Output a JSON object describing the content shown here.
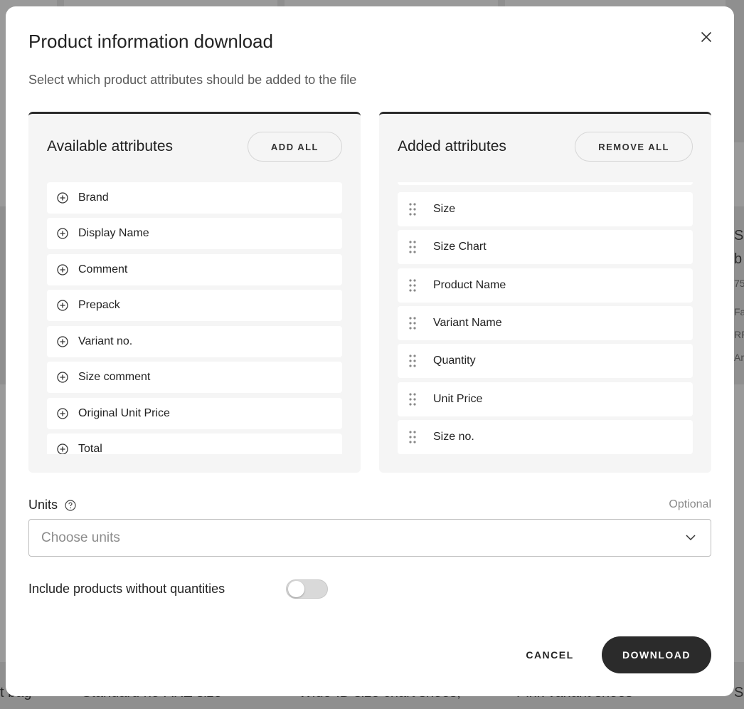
{
  "modal": {
    "title": "Product information download",
    "subtitle": "Select which product attributes should be added to the file"
  },
  "available": {
    "title": "Available attributes",
    "add_all_label": "ADD ALL",
    "items": [
      {
        "label": "Brand"
      },
      {
        "label": "Display Name"
      },
      {
        "label": "Comment"
      },
      {
        "label": "Prepack"
      },
      {
        "label": "Variant no."
      },
      {
        "label": "Size comment"
      },
      {
        "label": "Original Unit Price"
      },
      {
        "label": "Total"
      }
    ]
  },
  "added": {
    "title": "Added attributes",
    "remove_all_label": "REMOVE ALL",
    "items": [
      {
        "label": "Size"
      },
      {
        "label": "Size Chart"
      },
      {
        "label": "Product Name"
      },
      {
        "label": "Variant Name"
      },
      {
        "label": "Quantity"
      },
      {
        "label": "Unit Price"
      },
      {
        "label": "Size no."
      }
    ]
  },
  "units": {
    "label": "Units",
    "optional_label": "Optional",
    "placeholder": "Choose units"
  },
  "toggle": {
    "label": "Include products without quantities",
    "checked": false
  },
  "actions": {
    "cancel_label": "CANCEL",
    "download_label": "DOWNLOAD"
  },
  "icons": {
    "close": "close-icon",
    "add": "plus-circle-icon",
    "drag": "drag-handle-icon",
    "help": "help-circle-icon",
    "chevron": "chevron-down-icon"
  },
  "colors": {
    "primary_button": "#2b2b2b",
    "panel_bg": "#f5f5f5",
    "panel_border_top": "#2b2b2b"
  },
  "background_page": {
    "texts": [
      "S",
      "b",
      "75",
      "Fa",
      "RF",
      "Ar",
      "t bag",
      "Standard no-AHZ size",
      "Wide-ID size chart shoes,",
      "Pink variant shoes",
      "S"
    ]
  }
}
